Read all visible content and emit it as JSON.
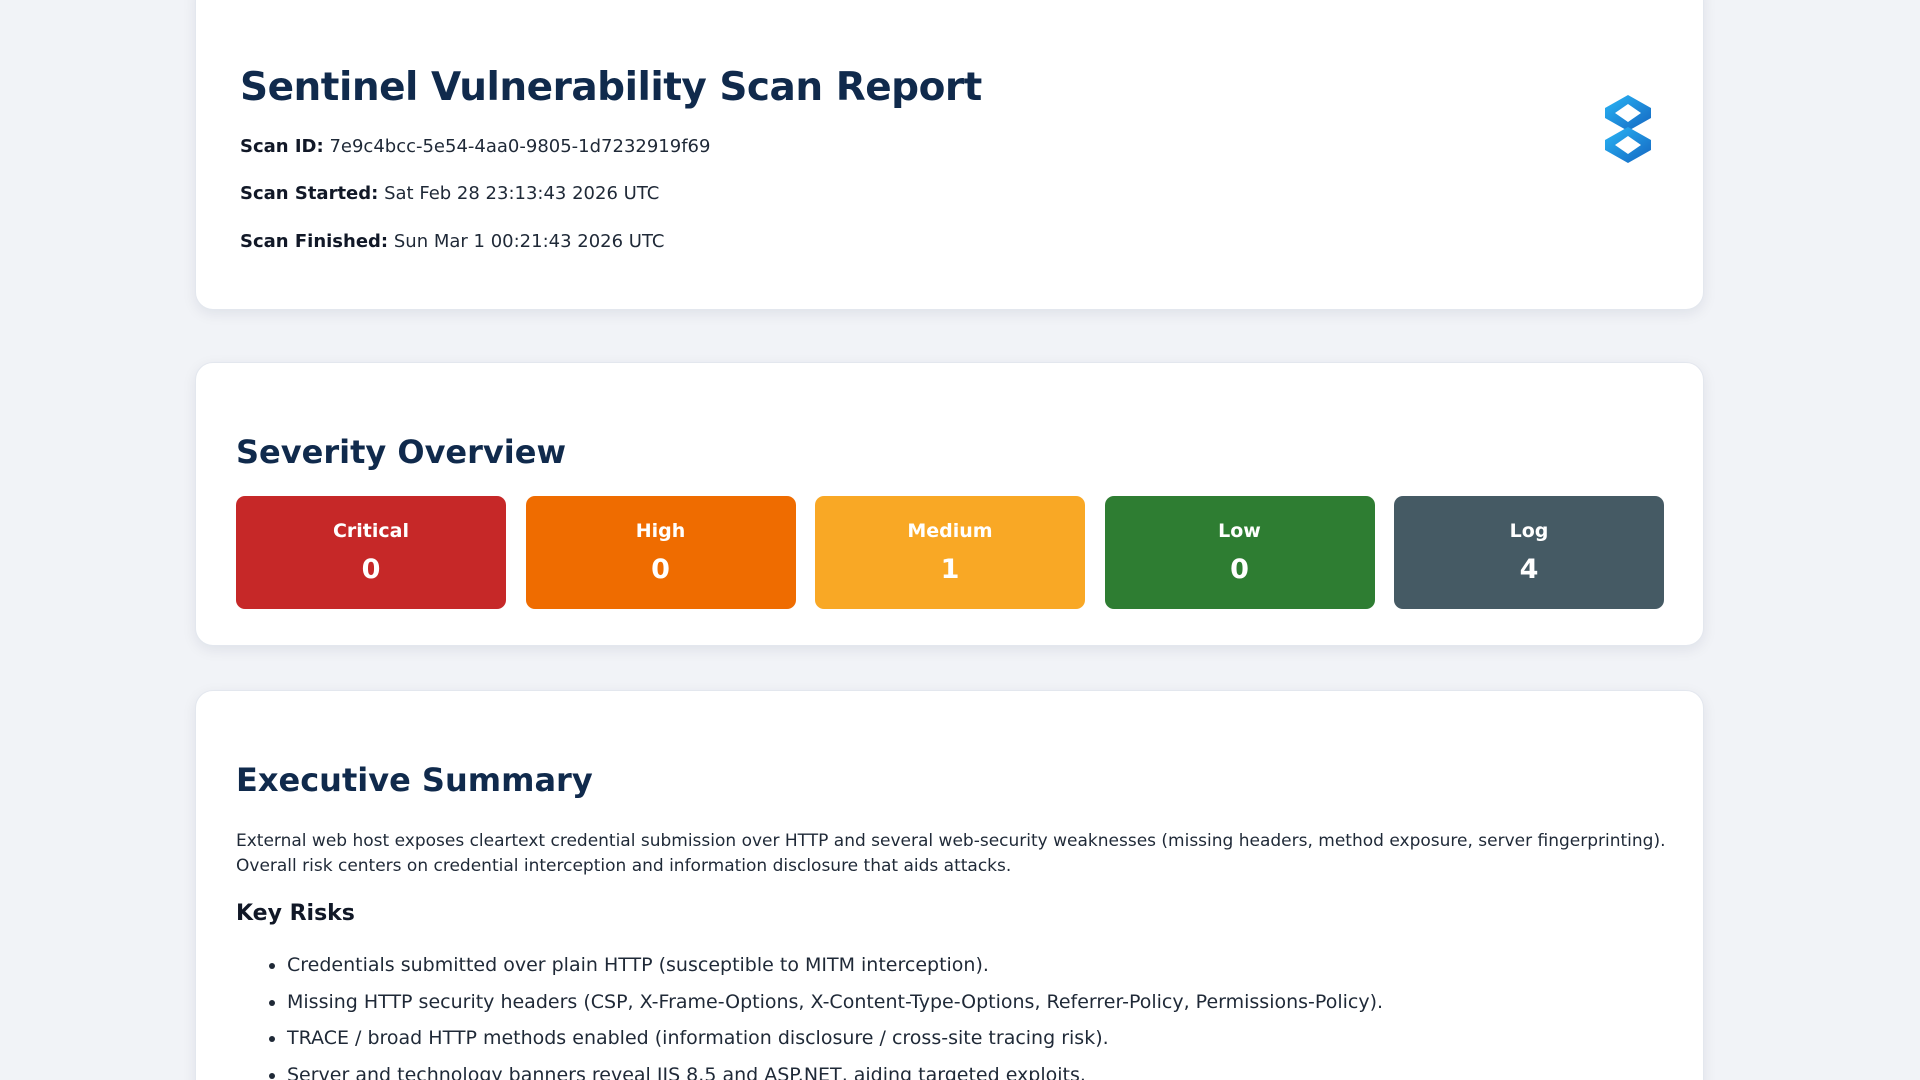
{
  "header": {
    "title": "Sentinel Vulnerability Scan Report",
    "scan_id_label": "Scan ID:",
    "scan_id": "7e9c4bcc-5e54-4aa0-9805-1d7232919f69",
    "scan_started_label": "Scan Started:",
    "scan_started": "Sat Feb 28 23:13:43 2026 UTC",
    "scan_finished_label": "Scan Finished:",
    "scan_finished": "Sun Mar 1 00:21:43 2026 UTC",
    "logo_icon": "sentinel-logo-icon"
  },
  "severity": {
    "title": "Severity Overview",
    "items": [
      {
        "label": "Critical",
        "count": "0",
        "color": "#c62828"
      },
      {
        "label": "High",
        "count": "0",
        "color": "#ef6c00"
      },
      {
        "label": "Medium",
        "count": "1",
        "color": "#f9a825"
      },
      {
        "label": "Low",
        "count": "0",
        "color": "#2e7d32"
      },
      {
        "label": "Log",
        "count": "4",
        "color": "#455a64"
      }
    ]
  },
  "summary": {
    "title": "Executive Summary",
    "text": "External web host exposes cleartext credential submission over HTTP and several web-security weaknesses (missing headers, method exposure, server fingerprinting). Overall risk centers on credential interception and information disclosure that aids attacks.",
    "key_risks_title": "Key Risks",
    "key_risks": [
      "Credentials submitted over plain HTTP (susceptible to MITM interception).",
      "Missing HTTP security headers (CSP, X-Frame-Options, X-Content-Type-Options, Referrer-Policy, Permissions-Policy).",
      "TRACE / broad HTTP methods enabled (information disclosure / cross-site tracing risk).",
      "Server and technology banners reveal IIS 8.5 and ASP.NET, aiding targeted exploits."
    ]
  }
}
